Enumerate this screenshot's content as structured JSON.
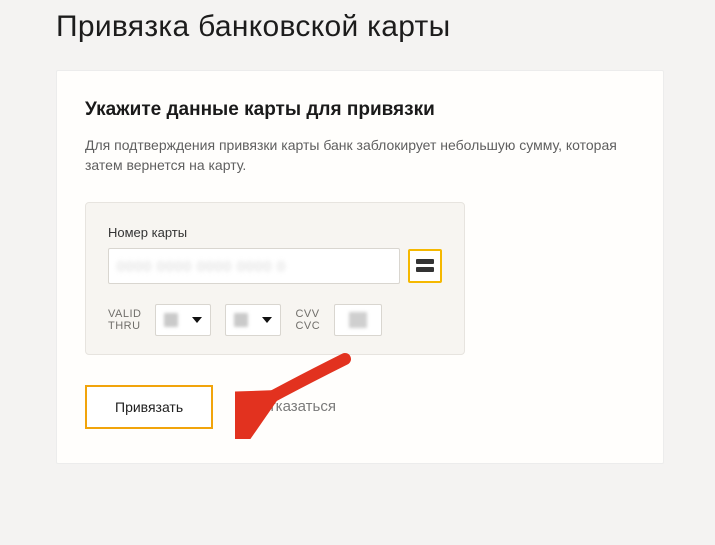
{
  "page": {
    "title": "Привязка банковской карты"
  },
  "form": {
    "heading": "Укажите данные карты для привязки",
    "description": "Для подтверждения привязки карты банк заблокирует небольшую сумму, которая затем вернется на карту.",
    "card_number_label": "Номер карты",
    "card_number_value": "0000 0000 0000 0000 0",
    "valid_thru_label_line1": "VALID",
    "valid_thru_label_line2": "THRU",
    "cvv_label_line1": "CVV",
    "cvv_label_line2": "CVC"
  },
  "actions": {
    "primary": "Привязать",
    "secondary": "Отказаться"
  }
}
